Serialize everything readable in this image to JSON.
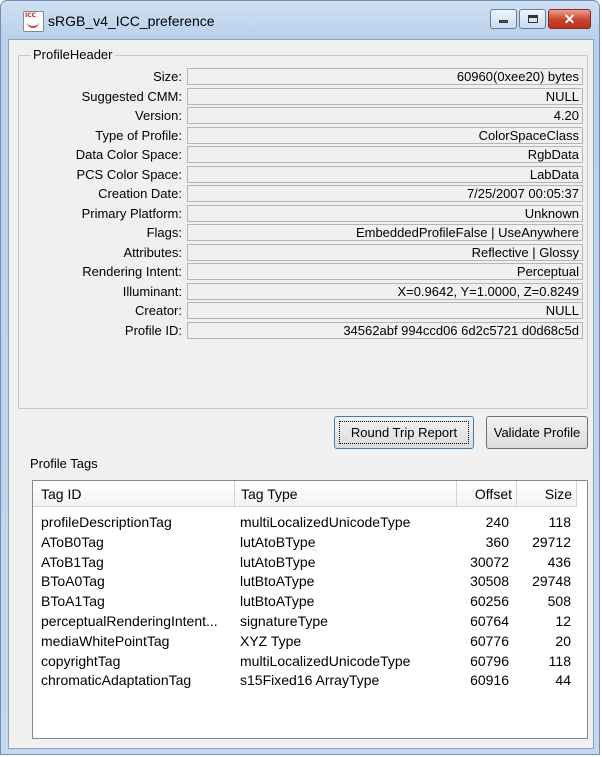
{
  "window": {
    "title": "sRGB_v4_ICC_preference",
    "app_icon_text": "ICC",
    "controls": {
      "minimize": "minimize-icon",
      "maximize": "maximize-icon",
      "close": "✕"
    }
  },
  "profile_header": {
    "legend": "ProfileHeader",
    "fields": [
      {
        "label": "Size:",
        "value": "60960(0xee20) bytes"
      },
      {
        "label": "Suggested CMM:",
        "value": "NULL"
      },
      {
        "label": "Version:",
        "value": "4.20"
      },
      {
        "label": "Type of Profile:",
        "value": "ColorSpaceClass"
      },
      {
        "label": "Data Color Space:",
        "value": "RgbData"
      },
      {
        "label": "PCS Color Space:",
        "value": "LabData"
      },
      {
        "label": "Creation Date:",
        "value": "7/25/2007 00:05:37"
      },
      {
        "label": "Primary Platform:",
        "value": "Unknown"
      },
      {
        "label": "Flags:",
        "value": "EmbeddedProfileFalse | UseAnywhere"
      },
      {
        "label": "Attributes:",
        "value": "Reflective | Glossy"
      },
      {
        "label": "Rendering Intent:",
        "value": "Perceptual"
      },
      {
        "label": "Illuminant:",
        "value": "X=0.9642, Y=1.0000, Z=0.8249"
      },
      {
        "label": "Creator:",
        "value": "NULL"
      },
      {
        "label": "Profile ID:",
        "value": "34562abf 994ccd06 6d2c5721 d0d68c5d"
      }
    ]
  },
  "buttons": {
    "round_trip": "Round Trip Report",
    "validate": "Validate Profile"
  },
  "profile_tags": {
    "label": "Profile Tags",
    "columns": [
      "Tag ID",
      "Tag Type",
      "Offset",
      "Size"
    ],
    "rows": [
      [
        "profileDescriptionTag",
        "multiLocalizedUnicodeType",
        "240",
        "118"
      ],
      [
        "AToB0Tag",
        "lutAtoBType",
        "360",
        "29712"
      ],
      [
        "AToB1Tag",
        "lutAtoBType",
        "30072",
        "436"
      ],
      [
        "BToA0Tag",
        "lutBtoAType",
        "30508",
        "29748"
      ],
      [
        "BToA1Tag",
        "lutBtoAType",
        "60256",
        "508"
      ],
      [
        "perceptualRenderingIntent...",
        "signatureType",
        "60764",
        "12"
      ],
      [
        "mediaWhitePointTag",
        "XYZ Type",
        "60776",
        "20"
      ],
      [
        "copyrightTag",
        "multiLocalizedUnicodeType",
        "60796",
        "118"
      ],
      [
        "chromaticAdaptationTag",
        "s15Fixed16 ArrayType",
        "60916",
        "44"
      ]
    ]
  }
}
